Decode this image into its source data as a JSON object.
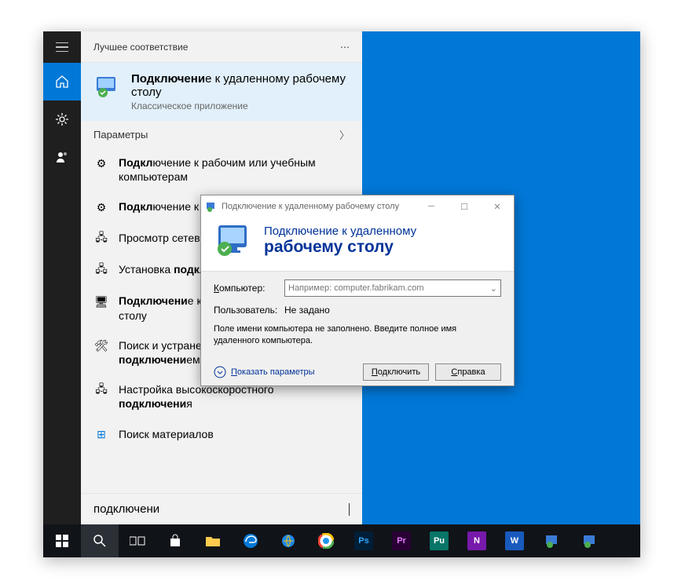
{
  "start": {
    "header": "Лучшее соответствие",
    "best": {
      "title_pre": "Подключени",
      "title_bold_suffix": "е",
      "title_rest": " к удаленному рабочему столу",
      "subtitle": "Классическое приложение"
    },
    "section_label": "Параметры",
    "items": [
      "Подключение к рабочим или учебным компьютерам",
      "Подключение к рабочему месту или домену",
      "Просмотр сетевых подключений",
      "Установка подключения к сети",
      "Подключение к удаленному рабочему столу",
      "Поиск и устранение проблем с сетью и подключением",
      "Настройка высокоскоростного подключения"
    ],
    "materials": "Поиск материалов",
    "search_value": "подключени"
  },
  "rdc": {
    "title": "Подключение к удаленному рабочему столу",
    "banner_line1": "Подключение к удаленному",
    "banner_line2": "рабочему столу",
    "label_computer": "Компьютер:",
    "placeholder_computer": "Например: computer.fabrikam.com",
    "label_user": "Пользователь:",
    "value_user": "Не задано",
    "hint": "Поле имени компьютера не заполнено. Введите полное имя удаленного компьютера.",
    "show_options": "Показать параметры",
    "btn_connect": "Подключить",
    "btn_help": "Справка"
  },
  "taskbar_apps": [
    "Ps",
    "Pr",
    "Pu",
    "N",
    "W"
  ]
}
